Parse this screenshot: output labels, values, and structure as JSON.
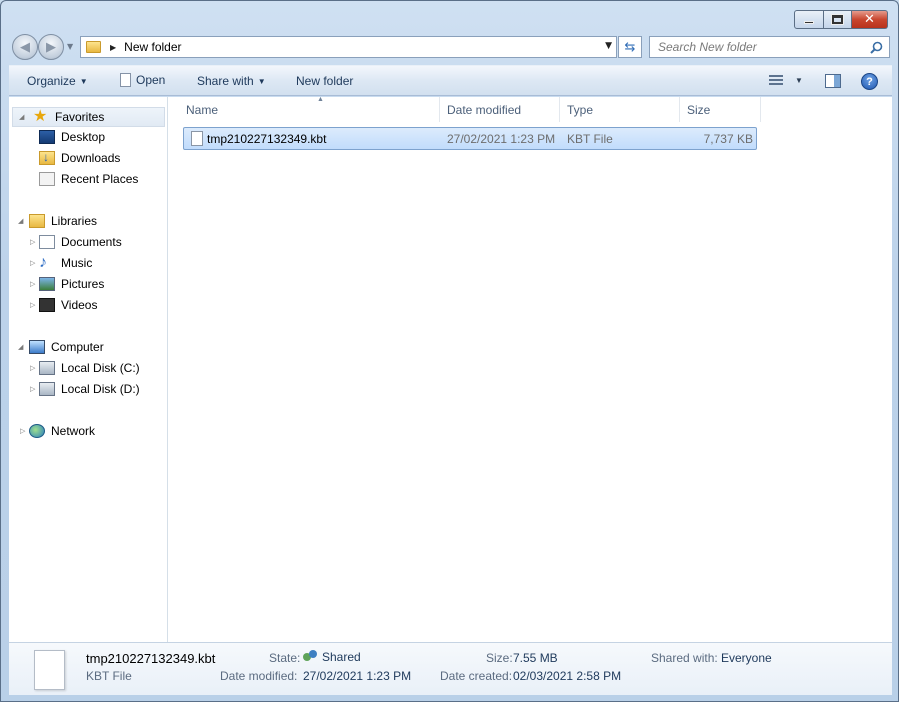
{
  "window": {
    "close_glyph": "✕"
  },
  "address": {
    "crumb": "New folder"
  },
  "search": {
    "placeholder": "Search New folder"
  },
  "toolbar": {
    "organize": "Organize",
    "open": "Open",
    "share_with": "Share with",
    "new_folder": "New folder"
  },
  "nav": {
    "favorites": {
      "label": "Favorites",
      "items": [
        "Desktop",
        "Downloads",
        "Recent Places"
      ]
    },
    "libraries": {
      "label": "Libraries",
      "items": [
        "Documents",
        "Music",
        "Pictures",
        "Videos"
      ]
    },
    "computer": {
      "label": "Computer",
      "items": [
        "Local Disk (C:)",
        "Local Disk (D:)"
      ]
    },
    "network": {
      "label": "Network"
    }
  },
  "columns": {
    "name": "Name",
    "date_modified": "Date modified",
    "type": "Type",
    "size": "Size"
  },
  "files": [
    {
      "name": "tmp210227132349.kbt",
      "date_modified": "27/02/2021 1:23 PM",
      "type": "KBT File",
      "size": "7,737 KB"
    }
  ],
  "details": {
    "name": "tmp210227132349.kbt",
    "type": "KBT File",
    "state_label": "State:",
    "state_value": "Shared",
    "date_modified_label": "Date modified:",
    "date_modified_value": "27/02/2021 1:23 PM",
    "size_label": "Size:",
    "size_value": "7.55 MB",
    "date_created_label": "Date created:",
    "date_created_value": "02/03/2021 2:58 PM",
    "shared_with_label": "Shared with:",
    "shared_with_value": "Everyone"
  },
  "icons": {
    "back": "arrow-left-icon",
    "forward": "arrow-right-icon",
    "refresh": "refresh-icon",
    "search": "search-icon",
    "help": "help-icon"
  }
}
